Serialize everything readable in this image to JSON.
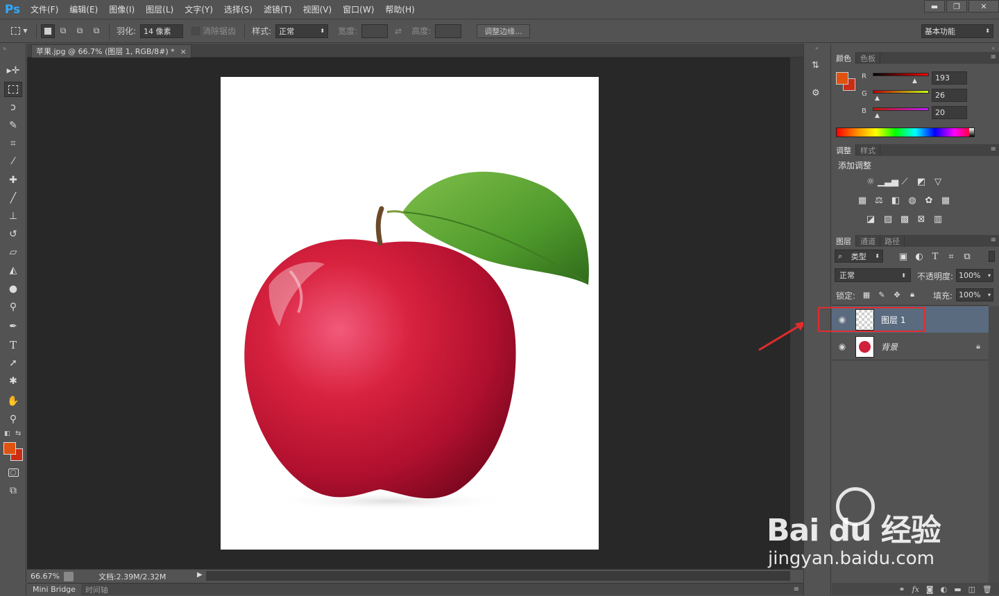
{
  "app": {
    "logo": "Ps"
  },
  "menu": [
    "文件(F)",
    "编辑(E)",
    "图像(I)",
    "图层(L)",
    "文字(Y)",
    "选择(S)",
    "滤镜(T)",
    "视图(V)",
    "窗口(W)",
    "帮助(H)"
  ],
  "window_controls": {
    "minimize": "▬",
    "restore": "❐",
    "close": "✕"
  },
  "options": {
    "feather_label": "羽化:",
    "feather_value": "14 像素",
    "antialias_label": "消除锯齿",
    "style_label": "样式:",
    "style_value": "正常",
    "width_label": "宽度:",
    "height_label": "高度:",
    "refine_edge": "调整边缘...",
    "workspace": "基本功能"
  },
  "document": {
    "tab_title": "苹果.jpg @ 66.7% (图层 1, RGB/8#) *",
    "zoom": "66.67%",
    "doc_size": "文档:2.39M/2.32M"
  },
  "bottom_tabs": [
    "Mini Bridge",
    "时间轴"
  ],
  "color_panel": {
    "tabs": [
      "颜色",
      "色板"
    ],
    "r_label": "R",
    "g_label": "G",
    "b_label": "B",
    "r": "193",
    "g": "26",
    "b": "20",
    "foreground": "#c11a14",
    "background": "#cc2c14",
    "fg_swatch": "#e0520f"
  },
  "adjustments_panel": {
    "tabs": [
      "调整",
      "样式"
    ],
    "title": "添加调整"
  },
  "layers_panel": {
    "tabs": [
      "图层",
      "通道",
      "路径"
    ],
    "filter_kind": "类型",
    "blend_mode": "正常",
    "opacity_label": "不透明度:",
    "opacity": "100%",
    "lock_label": "锁定:",
    "fill_label": "填充:",
    "fill": "100%",
    "layers": [
      {
        "name": "图层 1",
        "selected": true
      },
      {
        "name": "背景",
        "locked": true
      }
    ]
  },
  "watermark": {
    "brand": "Bai du 经验",
    "url": "jingyan.baidu.com"
  },
  "colors": {
    "accent": "#31a8ff",
    "highlight_box": "#e22c2c",
    "selected_layer": "#5a6b80"
  }
}
